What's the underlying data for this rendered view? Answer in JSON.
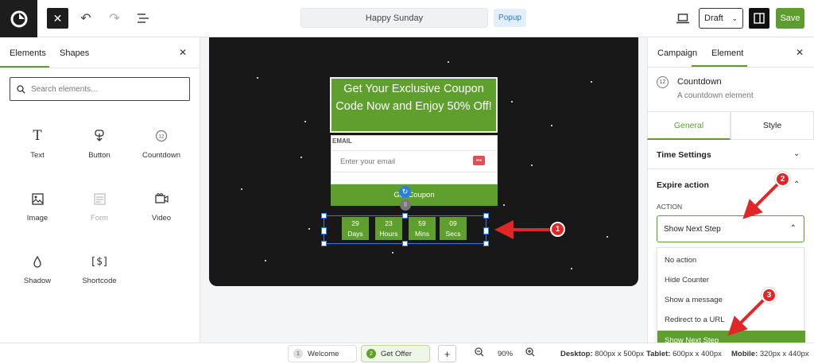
{
  "topbar": {
    "title": "Happy Sunday",
    "badge": "Popup",
    "status": "Draft",
    "save_label": "Save"
  },
  "left_panel": {
    "tabs": [
      "Elements",
      "Shapes"
    ],
    "search_placeholder": "Search elements...",
    "elements": [
      {
        "label": "Text",
        "icon": "text-icon"
      },
      {
        "label": "Button",
        "icon": "button-icon"
      },
      {
        "label": "Countdown",
        "icon": "countdown-icon"
      },
      {
        "label": "Image",
        "icon": "image-icon"
      },
      {
        "label": "Form",
        "icon": "form-icon"
      },
      {
        "label": "Video",
        "icon": "video-icon"
      },
      {
        "label": "Shadow",
        "icon": "shadow-icon"
      },
      {
        "label": "Shortcode",
        "icon": "shortcode-icon"
      }
    ]
  },
  "canvas": {
    "headline": "Get Your Exclusive Coupon Code Now and Enjoy 50% Off!",
    "email_label": "EMAIL",
    "email_placeholder": "Enter your email",
    "cta": "Get Coupon",
    "countdown": [
      {
        "value": "29",
        "unit": "Days"
      },
      {
        "value": "23",
        "unit": "Hours"
      },
      {
        "value": "59",
        "unit": "Mins"
      },
      {
        "value": "09",
        "unit": "Secs"
      }
    ]
  },
  "right_panel": {
    "tabs": [
      "Campaign",
      "Element"
    ],
    "element_title": "Countdown",
    "element_desc": "A countdown element",
    "subtabs": [
      "General",
      "Style"
    ],
    "section_time": "Time Settings",
    "section_expire": "Expire action",
    "action_label": "ACTION",
    "action_value": "Show Next Step",
    "options": [
      "No action",
      "Hide Counter",
      "Show a message",
      "Redirect to a URL",
      "Show Next Step"
    ]
  },
  "bottombar": {
    "steps": [
      {
        "num": "1",
        "label": "Welcome"
      },
      {
        "num": "2",
        "label": "Get Offer"
      }
    ],
    "zoom": "90%",
    "desktop_label": "Desktop:",
    "desktop_value": "800px x 500px",
    "tablet_label": "Tablet:",
    "tablet_value": "600px x 400px",
    "mobile_label": "Mobile:",
    "mobile_value": "320px x 440px"
  },
  "annotations": [
    "1",
    "2",
    "3"
  ],
  "colors": {
    "accent": "#5e9f2e",
    "select": "#2a7de1",
    "annotation": "#e02626"
  }
}
